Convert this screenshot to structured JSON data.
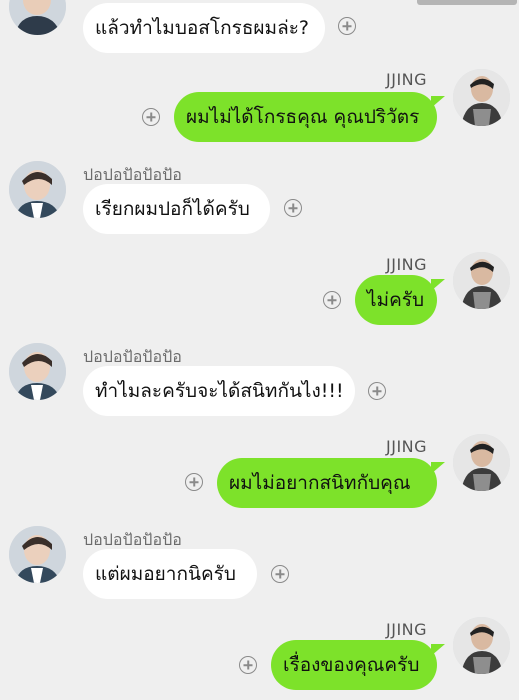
{
  "messages": [
    {
      "side": "left",
      "sender": "",
      "text": "แล้วทำไมบอสโกรธผมล่ะ?"
    },
    {
      "side": "right",
      "sender": "JJING",
      "text": "ผมไม่ได้โกรธคุณ คุณปริวัตร"
    },
    {
      "side": "left",
      "sender": "ปอปอปัอปัอปัอ",
      "text": "เรียกผมปอก็ได้ครับ"
    },
    {
      "side": "right",
      "sender": "JJING",
      "text": "ไม่ครับ"
    },
    {
      "side": "left",
      "sender": "ปอปอปัอปัอปัอ",
      "text": "ทำไมละครับจะได้สนิทกันไง!!!"
    },
    {
      "side": "right",
      "sender": "JJING",
      "text": "ผมไม่อยากสนิทกับคุณ"
    },
    {
      "side": "left",
      "sender": "ปอปอปัอปัอปัอ",
      "text": "แต่ผมอยากนิครับ"
    },
    {
      "side": "right",
      "sender": "JJING",
      "text": "เรื่องของคุณครับ"
    }
  ],
  "icons": {
    "add": "plus-circle-icon",
    "avatar_left": "avatar-photo",
    "avatar_right": "avatar-photo"
  },
  "colors": {
    "background": "#efefef",
    "bubble_left": "#ffffff",
    "bubble_right": "#7de22a"
  }
}
